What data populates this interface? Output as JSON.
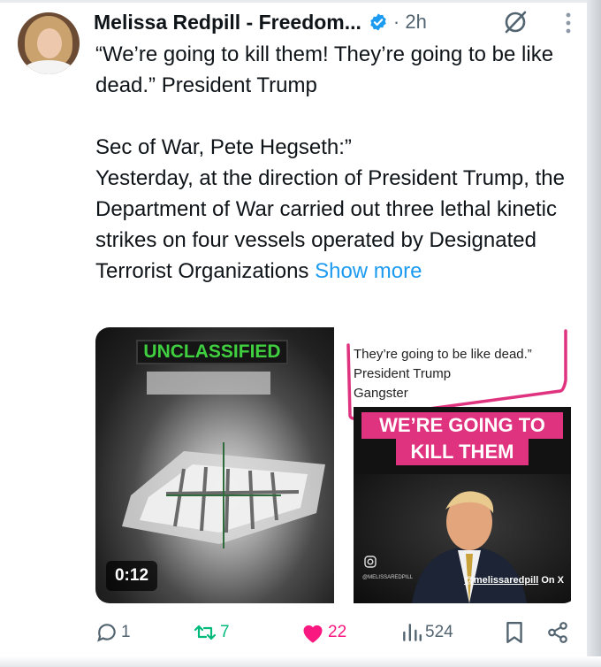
{
  "post": {
    "author_name": "Melissa Redpill - Freedom...",
    "time_ago": "· 2h",
    "text": "“We’re going to kill them! They’re going to be like dead.” President Trump\n\nSec of War, Pete Hegseth:”\nYesterday, at the direction of President Trump, the Department of War carried out three lethal kinetic strikes on four vessels operated by Designated Terrorist Organizations ",
    "show_more": "Show more"
  },
  "media": {
    "left": {
      "label": "UNCLASSIFIED",
      "duration": "0:12"
    },
    "right": {
      "quote": "They’re going to be like dead.”\nPresident Trump\nGangster",
      "banner_line1": "WE’RE GOING TO",
      "banner_line2": "KILL THEM",
      "watermark": "@MELISSAREDPILL",
      "handle": "@melissaredpill",
      "handle_suffix": " On X"
    }
  },
  "actions": {
    "replies": "1",
    "reposts": "7",
    "likes": "22",
    "views": "524"
  },
  "colors": {
    "link": "#1d9bf0",
    "like": "#f91880",
    "repost": "#00ba7c",
    "banner": "#e0337f",
    "label_green": "#3fcf3f"
  },
  "icons": [
    "verified-badge-icon",
    "grok-icon",
    "more-icon",
    "reply-icon",
    "repost-icon",
    "like-icon",
    "views-icon",
    "bookmark-icon",
    "share-icon",
    "instagram-icon"
  ]
}
